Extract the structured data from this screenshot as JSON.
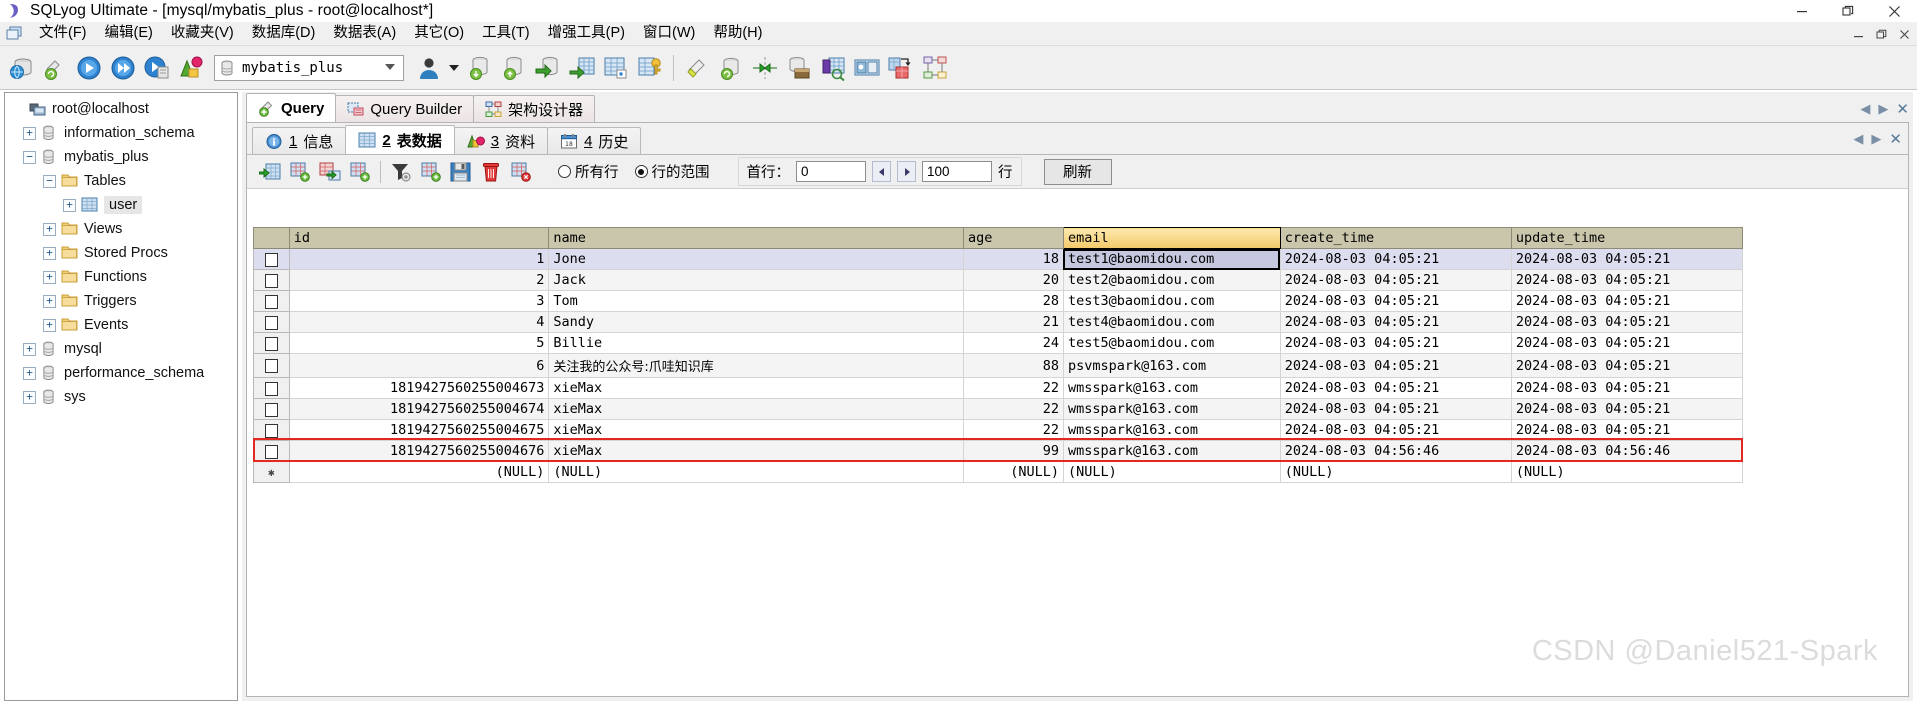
{
  "window": {
    "title": "SQLyog Ultimate - [mysql/mybatis_plus - root@localhost*]",
    "app_icon": "sqlyog-icon",
    "minimize": "minimize-icon",
    "maximize": "restore-icon",
    "close": "close-icon"
  },
  "menubar": {
    "icon": "mdi-window-icon",
    "items": [
      {
        "label": "文件(F)",
        "name": "menu-file"
      },
      {
        "label": "编辑(E)",
        "name": "menu-edit"
      },
      {
        "label": "收藏夹(V)",
        "name": "menu-favorites"
      },
      {
        "label": "数据库(D)",
        "name": "menu-database"
      },
      {
        "label": "数据表(A)",
        "name": "menu-table"
      },
      {
        "label": "其它(O)",
        "name": "menu-other"
      },
      {
        "label": "工具(T)",
        "name": "menu-tools"
      },
      {
        "label": "增强工具(P)",
        "name": "menu-powertools"
      },
      {
        "label": "窗口(W)",
        "name": "menu-window"
      },
      {
        "label": "帮助(H)",
        "name": "menu-help"
      }
    ],
    "mdi_buttons": [
      "minimize",
      "restore",
      "close"
    ]
  },
  "toolbar": {
    "database_value": "mybatis_plus",
    "icons": [
      "new-connection-icon",
      "refresh-object-browser-icon",
      "execute-query-icon",
      "execute-all-queries-icon",
      "execute-query-stop-icon",
      "explain-query-icon"
    ],
    "icons2": [
      "user-manager-icon",
      "backup-database-icon",
      "restore-database-icon",
      "import-external-data-icon",
      "export-table-icon",
      "create-table-icon",
      "alter-table-icon",
      "manage-indexes-icon"
    ],
    "icons3": [
      "sql-formatter-icon",
      "flush-icon",
      "sync-data-icon",
      "schema-sync-icon",
      "data-search-icon",
      "visual-diff-icon",
      "migrate-icon",
      "schema-designer-icon"
    ]
  },
  "sidebar": {
    "root": "root@localhost",
    "items": [
      {
        "label": "root@localhost",
        "icon": "host-icon",
        "indent": 0,
        "expander": "",
        "selected": false
      },
      {
        "label": "information_schema",
        "icon": "database-icon",
        "indent": 1,
        "expander": "+",
        "selected": false
      },
      {
        "label": "mybatis_plus",
        "icon": "database-icon",
        "indent": 1,
        "expander": "−",
        "selected": false
      },
      {
        "label": "Tables",
        "icon": "folder-icon",
        "indent": 2,
        "expander": "−",
        "selected": false
      },
      {
        "label": "user",
        "icon": "table-icon",
        "indent": 3,
        "expander": "+",
        "selected": true
      },
      {
        "label": "Views",
        "icon": "folder-icon",
        "indent": 2,
        "expander": "+",
        "selected": false
      },
      {
        "label": "Stored Procs",
        "icon": "folder-icon",
        "indent": 2,
        "expander": "+",
        "selected": false
      },
      {
        "label": "Functions",
        "icon": "folder-icon",
        "indent": 2,
        "expander": "+",
        "selected": false
      },
      {
        "label": "Triggers",
        "icon": "folder-icon",
        "indent": 2,
        "expander": "+",
        "selected": false
      },
      {
        "label": "Events",
        "icon": "folder-icon",
        "indent": 2,
        "expander": "+",
        "selected": false
      },
      {
        "label": "mysql",
        "icon": "database-icon",
        "indent": 1,
        "expander": "+",
        "selected": false
      },
      {
        "label": "performance_schema",
        "icon": "database-icon",
        "indent": 1,
        "expander": "+",
        "selected": false
      },
      {
        "label": "sys",
        "icon": "database-icon",
        "indent": 1,
        "expander": "+",
        "selected": false
      }
    ]
  },
  "editor_tabs": [
    {
      "label": "Query",
      "icon": "query-icon",
      "active": true
    },
    {
      "label": "Query Builder",
      "icon": "query-builder-icon",
      "active": false
    },
    {
      "label": "架构设计器",
      "icon": "schema-designer-icon",
      "active": false
    }
  ],
  "result_tabs": [
    {
      "num": "1",
      "label": "信息",
      "icon": "info-icon",
      "active": false
    },
    {
      "num": "2",
      "label": "表数据",
      "icon": "table-data-icon",
      "active": true
    },
    {
      "num": "3",
      "label": "资料",
      "icon": "profile-icon",
      "active": false
    },
    {
      "num": "4",
      "label": "历史",
      "icon": "calendar-icon",
      "active": false
    }
  ],
  "grid_toolbar": {
    "icons": [
      "insert-row-icon",
      "duplicate-row-icon",
      "copy-row-icon",
      "add-row-icon",
      "filter-icon",
      "new-record-icon",
      "save-changes-icon",
      "delete-row-icon",
      "cancel-changes-icon"
    ],
    "radio_all_rows": "所有行",
    "radio_range": "行的范围",
    "radio_selected": "range",
    "first_row_label": "首行：",
    "first_row_value": "0",
    "limit_value": "100",
    "rows_unit": "行",
    "refresh_label": "刷新"
  },
  "grid": {
    "columns": [
      "id",
      "name",
      "age",
      "email",
      "create_time",
      "update_time"
    ],
    "selected_column": "email",
    "rows": [
      {
        "id": "1",
        "name": "Jone",
        "age": "18",
        "email": "test1@baomidou.com",
        "create_time": "2024-08-03 04:05:21",
        "update_time": "2024-08-03 04:05:21",
        "selected": true,
        "current": true,
        "highlight": false
      },
      {
        "id": "2",
        "name": "Jack",
        "age": "20",
        "email": "test2@baomidou.com",
        "create_time": "2024-08-03 04:05:21",
        "update_time": "2024-08-03 04:05:21",
        "selected": false,
        "current": false,
        "highlight": false
      },
      {
        "id": "3",
        "name": "Tom",
        "age": "28",
        "email": "test3@baomidou.com",
        "create_time": "2024-08-03 04:05:21",
        "update_time": "2024-08-03 04:05:21",
        "selected": false,
        "current": false,
        "highlight": false
      },
      {
        "id": "4",
        "name": "Sandy",
        "age": "21",
        "email": "test4@baomidou.com",
        "create_time": "2024-08-03 04:05:21",
        "update_time": "2024-08-03 04:05:21",
        "selected": false,
        "current": false,
        "highlight": false
      },
      {
        "id": "5",
        "name": "Billie",
        "age": "24",
        "email": "test5@baomidou.com",
        "create_time": "2024-08-03 04:05:21",
        "update_time": "2024-08-03 04:05:21",
        "selected": false,
        "current": false,
        "highlight": false
      },
      {
        "id": "6",
        "name": "关注我的公众号:爪哇知识库",
        "age": "88",
        "email": "psvmspark@163.com",
        "create_time": "2024-08-03 04:05:21",
        "update_time": "2024-08-03 04:05:21",
        "selected": false,
        "current": false,
        "highlight": false
      },
      {
        "id": "1819427560255004673",
        "name": "xieMax",
        "age": "22",
        "email": "wmsspark@163.com",
        "create_time": "2024-08-03 04:05:21",
        "update_time": "2024-08-03 04:05:21",
        "selected": false,
        "current": false,
        "highlight": false
      },
      {
        "id": "1819427560255004674",
        "name": "xieMax",
        "age": "22",
        "email": "wmsspark@163.com",
        "create_time": "2024-08-03 04:05:21",
        "update_time": "2024-08-03 04:05:21",
        "selected": false,
        "current": false,
        "highlight": false
      },
      {
        "id": "1819427560255004675",
        "name": "xieMax",
        "age": "22",
        "email": "wmsspark@163.com",
        "create_time": "2024-08-03 04:05:21",
        "update_time": "2024-08-03 04:05:21",
        "selected": false,
        "current": false,
        "highlight": false
      },
      {
        "id": "1819427560255004676",
        "name": "xieMax",
        "age": "99",
        "email": "wmsspark@163.com",
        "create_time": "2024-08-03 04:56:46",
        "update_time": "2024-08-03 04:56:46",
        "selected": false,
        "current": false,
        "highlight": true
      }
    ],
    "null_row": {
      "id": "(NULL)",
      "name": "(NULL)",
      "age": "(NULL)",
      "email": "(NULL)",
      "create_time": "(NULL)",
      "update_time": "(NULL)"
    },
    "highlight_color": "#e2281f",
    "header_color": "#c9c6ab",
    "selected_row_color": "#dcdef0"
  },
  "watermark": "CSDN @Daniel521-Spark"
}
